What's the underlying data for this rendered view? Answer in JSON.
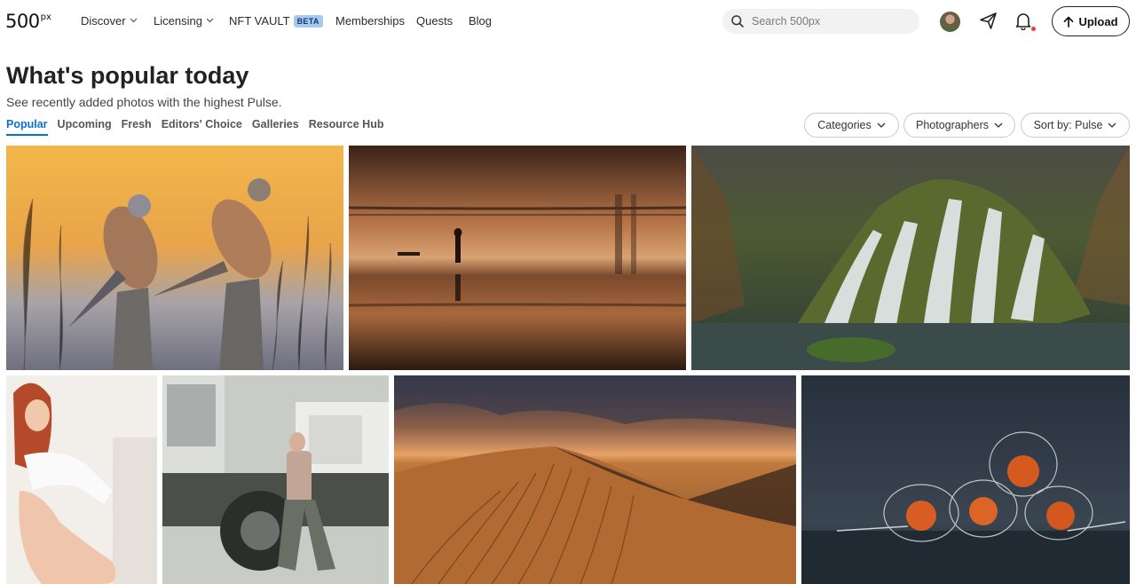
{
  "nav": {
    "logo_main": "500",
    "logo_sup": "px",
    "discover": "Discover",
    "licensing": "Licensing",
    "nft_vault": "NFT VAULT",
    "beta_badge": "BETA",
    "memberships": "Memberships",
    "quests": "Quests",
    "blog": "Blog",
    "search_placeholder": "Search 500px",
    "upload": "Upload",
    "notification_dot_color": "#e0453a"
  },
  "header": {
    "title": "What's popular today",
    "subtitle": "See recently added photos with the highest Pulse."
  },
  "tabs": [
    {
      "label": "Popular",
      "active": true
    },
    {
      "label": "Upcoming",
      "active": false
    },
    {
      "label": "Fresh",
      "active": false
    },
    {
      "label": "Editors' Choice",
      "active": false
    },
    {
      "label": "Galleries",
      "active": false
    },
    {
      "label": "Resource Hub",
      "active": false
    }
  ],
  "filters": {
    "categories": "Categories",
    "photographers": "Photographers",
    "sort": "Sort by: Pulse"
  },
  "photos": [
    {
      "subject": "two kestrels perched on dry stumps",
      "palette": [
        "#f0a53c",
        "#8d8f9c"
      ]
    },
    {
      "subject": "silhouette walking beside a foggy bridge at sunset",
      "palette": [
        "#b56a36",
        "#3d2418"
      ]
    },
    {
      "subject": "mossy waterfall cascading in autumn forest",
      "palette": [
        "#4a5a36",
        "#e8eef0"
      ]
    },
    {
      "subject": "red-haired woman in white top",
      "palette": [
        "#f1ece6",
        "#b54a2a"
      ]
    },
    {
      "subject": "woman leaning on truck wheel",
      "palette": [
        "#8a8f8c",
        "#3b3f3c"
      ]
    },
    {
      "subject": "rippled sand dune under cloudy sky",
      "palette": [
        "#b7723a",
        "#3a3d52"
      ]
    },
    {
      "subject": "physalis lanterns on glass",
      "palette": [
        "#2f3a45",
        "#d9622a"
      ]
    }
  ],
  "brand": {
    "accent": "#0870d1",
    "beta_bg": "#a9c8ee"
  }
}
